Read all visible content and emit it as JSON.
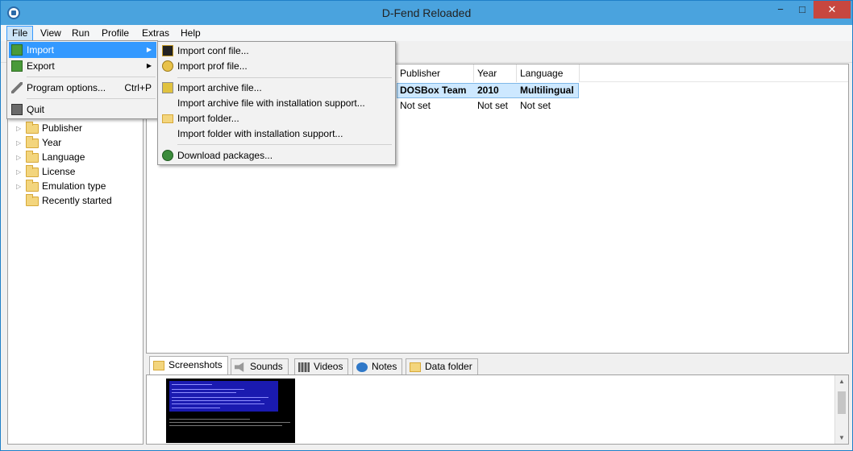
{
  "window": {
    "title": "D-Fend Reloaded",
    "minimize": "−",
    "maximize": "□",
    "close": "✕"
  },
  "menubar": [
    "File",
    "View",
    "Run",
    "Profile",
    "Extras",
    "Help"
  ],
  "file_menu": {
    "import": "Import",
    "export": "Export",
    "program_options": "Program options...",
    "program_options_shortcut": "Ctrl+P",
    "quit": "Quit"
  },
  "import_menu": {
    "conf": "Import conf file...",
    "prof": "Import prof file...",
    "archive": "Import archive file...",
    "archive_install": "Import archive file with installation support...",
    "folder": "Import folder...",
    "folder_install": "Import folder with installation support...",
    "download": "Download packages..."
  },
  "tree": [
    "Publisher",
    "Year",
    "Language",
    "License",
    "Emulation type",
    "Recently started"
  ],
  "list": {
    "columns": [
      "Publisher",
      "Year",
      "Language"
    ],
    "rows": [
      [
        "DOSBox Team",
        "2010",
        "Multilingual"
      ],
      [
        "Not set",
        "Not set",
        "Not set"
      ]
    ]
  },
  "tabs": [
    "Screenshots",
    "Sounds",
    "Videos",
    "Notes",
    "Data folder"
  ],
  "icons": {
    "app": "dfend-logo-icon",
    "import": "import-arrow-icon",
    "export": "export-arrow-icon",
    "options": "wrench-icon",
    "quit": "quit-icon"
  },
  "colors": {
    "titlebar": "#4aa3de",
    "highlight": "#3399ff",
    "selected_row": "#cde8ff",
    "close": "#c7473f"
  }
}
